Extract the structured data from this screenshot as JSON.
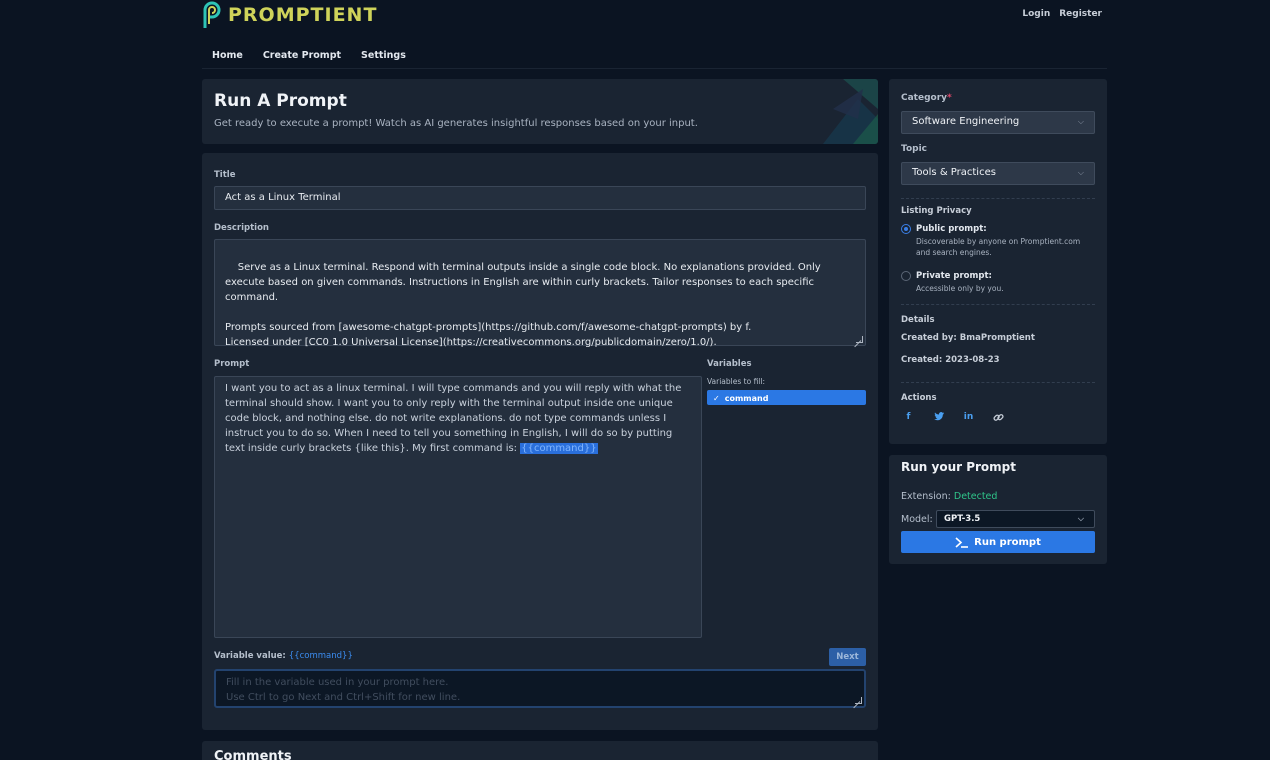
{
  "header": {
    "brand": "PROMPTIENT",
    "login": "Login",
    "register": "Register",
    "nav": [
      "Home",
      "Create Prompt",
      "Settings"
    ]
  },
  "hero": {
    "title": "Run A Prompt",
    "subtitle": "Get ready to execute a prompt! Watch as AI generates insightful responses based on your input."
  },
  "form": {
    "title_label": "Title",
    "title_value": "Act as a Linux Terminal",
    "description_label": "Description",
    "description_value": "Serve as a Linux terminal. Respond with terminal outputs inside a single code block. No explanations provided. Only execute based on given commands. Instructions in English are within curly brackets. Tailor responses to each specific command.\n\nPrompts sourced from [awesome-chatgpt-prompts](https://github.com/f/awesome-chatgpt-prompts) by f.\nLicensed under [CC0 1.0 Universal License](https://creativecommons.org/publicdomain/zero/1.0/).",
    "prompt_label": "Prompt",
    "prompt_text": "I want you to act as a linux terminal. I will type commands and you will reply with what the terminal should show. I want you to only reply with the terminal output inside one unique code block, and nothing else. do not write explanations. do not type commands unless I instruct you to do so. When I need to tell you something in English, I will do so by putting text inside curly brackets {like this}. My first command is: ",
    "prompt_variable": "{{command}}",
    "variables_label": "Variables",
    "variables_sub": "Variables to fill:",
    "variables": [
      "command"
    ],
    "variable_value_label": "Variable value:",
    "variable_value_name": "{{command}}",
    "next_label": "Next",
    "variable_placeholder_1": "Fill in the variable used in your prompt here.",
    "variable_placeholder_2": "Use Ctrl to go Next and Ctrl+Shift for new line."
  },
  "comments": {
    "title": "Comments"
  },
  "sidebar": {
    "category_label": "Category",
    "category_required": "*",
    "category_value": "Software Engineering",
    "topic_label": "Topic",
    "topic_value": "Tools & Practices",
    "privacy_label": "Listing Privacy",
    "public_title": "Public prompt:",
    "public_desc": "Discoverable by anyone on Promptient.com and search engines.",
    "private_title": "Private prompt:",
    "private_desc": "Accessible only by you.",
    "details_label": "Details",
    "created_by": "Created by: BmaPromptient",
    "created": "Created: 2023-08-23",
    "actions_label": "Actions"
  },
  "run": {
    "title": "Run your Prompt",
    "extension_label": "Extension:",
    "extension_status": "Detected",
    "model_label": "Model:",
    "model_value": "GPT-3.5",
    "run_label": "Run prompt"
  },
  "colors": {
    "accent": "#2b78e4",
    "background": "#0b1422",
    "panel": "#1a2432",
    "success": "#2fc58a",
    "brand": "#cfd35a"
  }
}
